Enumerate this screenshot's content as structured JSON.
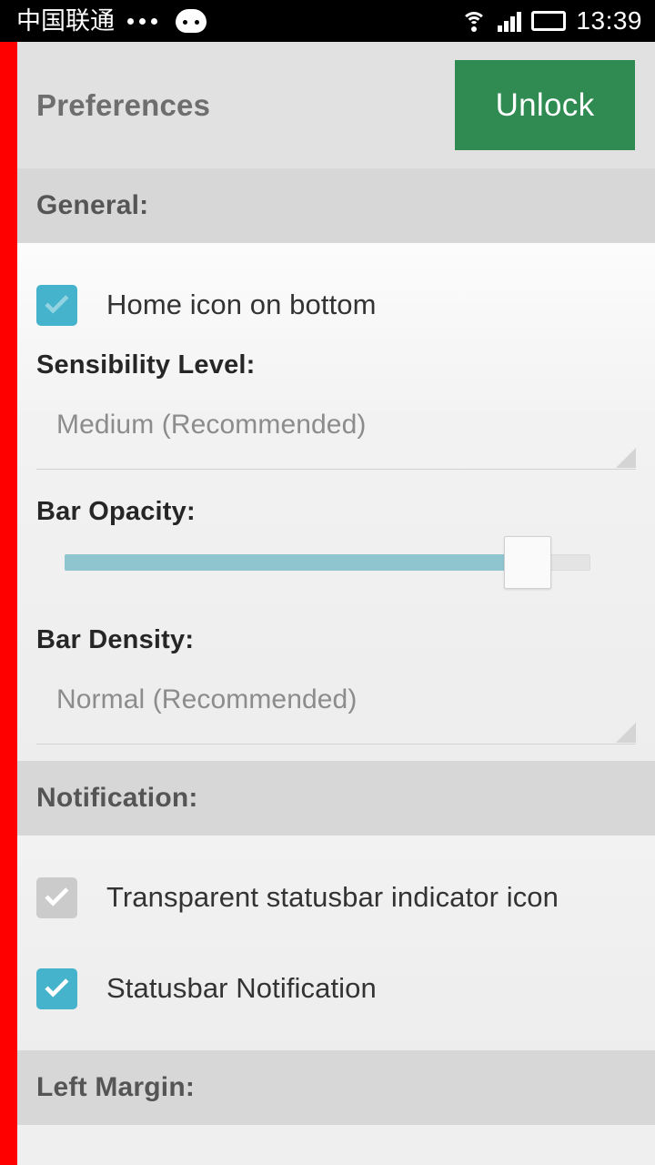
{
  "statusbar": {
    "carrier": "中国联通",
    "dots_icon": "more-dots-icon",
    "robot_icon": "android-robot-icon",
    "wifi_icon": "wifi-icon",
    "signal_icon": "cellular-signal-icon",
    "battery_icon": "battery-icon",
    "time": "13:39"
  },
  "header": {
    "title": "Preferences",
    "unlock_label": "Unlock",
    "unlock_color": "#2f8b51"
  },
  "edge_bar": {
    "color": "#fe0000",
    "name": "left-edge-trigger-bar"
  },
  "sections": [
    {
      "heading": "General:",
      "items": [
        {
          "type": "checkbox",
          "label": "Home icon on bottom",
          "checked": true,
          "state": "faded",
          "color": "#45b3cb"
        },
        {
          "type": "spinner",
          "label": "Sensibility Level:",
          "value": "Medium (Recommended)"
        },
        {
          "type": "slider",
          "label": "Bar Opacity:",
          "percent": 88,
          "fill_color": "#8ec5cf"
        },
        {
          "type": "spinner",
          "label": "Bar Density:",
          "value": "Normal (Recommended)"
        }
      ]
    },
    {
      "heading": "Notification:",
      "items": [
        {
          "type": "checkbox",
          "label": "Transparent statusbar indicator icon",
          "checked": true,
          "state": "disabled",
          "color": "#cbcbcb"
        },
        {
          "type": "checkbox",
          "label": "Statusbar Notification",
          "checked": true,
          "state": "on",
          "color": "#45b3cb"
        }
      ]
    },
    {
      "heading": "Left Margin:",
      "items": []
    }
  ]
}
